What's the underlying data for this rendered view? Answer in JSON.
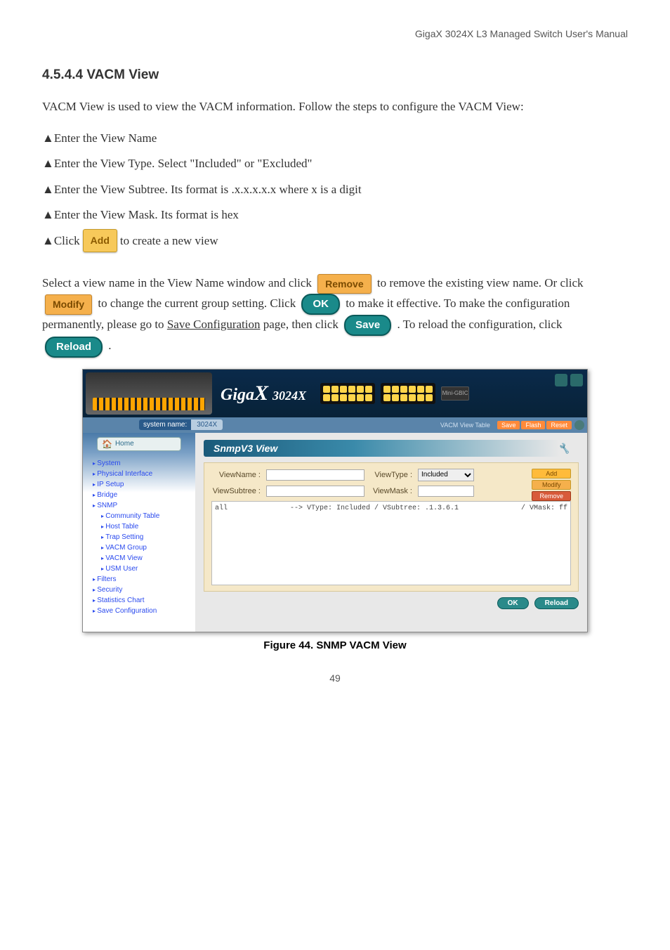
{
  "header_line": "GigaX 3024X L3 Managed Switch User's Manual",
  "section_title": "4.5.4.4 VACM View",
  "paragraphs": {
    "p1": "VACM View is used to view the VACM information. Follow the steps to configure the VACM View:",
    "p2_part1": "Select a view name in the View Name window and click ",
    "p2_part2": " to remove the existing view name. Or click ",
    "p2_part3": " to change the current group setting. Click ",
    "p2_part4": " to make it effective. To make the configuration permanently, please go to ",
    "p2_part5": " page, then click ",
    "p2_part6": ". To reload the configuration, click ",
    "p2_part7": "."
  },
  "steps": {
    "s1": "Enter the View Name",
    "s2_prefix": "Enter the View Type.",
    "s2_suffix": "Select \"Included\" or \"Excluded\"",
    "s3_prefix": "Enter the View Subtree.",
    "s3_suffix": "Its format is .x.x.x.x.x where x is a digit",
    "s4": "Enter the View Mask. Its format is hex",
    "s5_prefix": "Click ",
    "s5_suffix": " to create a new view"
  },
  "save_config_link": "Save Configuration",
  "buttons": {
    "add": "Add",
    "remove": "Remove",
    "modify": "Modify",
    "ok": "OK",
    "reload": "Reload",
    "save": "Save"
  },
  "screenshot": {
    "brand_prefix": "Giga",
    "brand_x": "X",
    "brand_model": "3024X",
    "mini_mod": "Mini-GBIC",
    "crumb_label": "system name:",
    "crumb_path": "3024X",
    "status_right": "VACM View Table",
    "tabs": [
      "Save",
      "Flash",
      "Reset"
    ],
    "home": "Home",
    "sidebar_items": [
      "System",
      "Physical Interface",
      "IP Setup",
      "Bridge",
      "SNMP"
    ],
    "sidebar_sub": [
      "Community Table",
      "Host Table",
      "Trap Setting",
      "VACM Group",
      "VACM View",
      "USM User"
    ],
    "sidebar_items_after": [
      "Filters",
      "Security",
      "Statistics Chart",
      "Save Configuration"
    ],
    "panel_title": "SnmpV3 View",
    "labels": {
      "view_name": "ViewName :",
      "view_type": "ViewType :",
      "view_subtree": "ViewSubtree :",
      "view_mask": "ViewMask :"
    },
    "view_type_options": [
      "Included"
    ],
    "mini_buttons": {
      "add": "Add",
      "modify": "Modify",
      "remove": "Remove"
    },
    "list_entry_left": "all",
    "list_entry_mid": "--> VType: Included / VSubtree: .1.3.6.1",
    "list_entry_right": "/ VMask: ff",
    "bottom_ok": "OK",
    "bottom_reload": "Reload"
  },
  "figure_caption": "Figure 44. SNMP VACM View",
  "page_number": "49"
}
